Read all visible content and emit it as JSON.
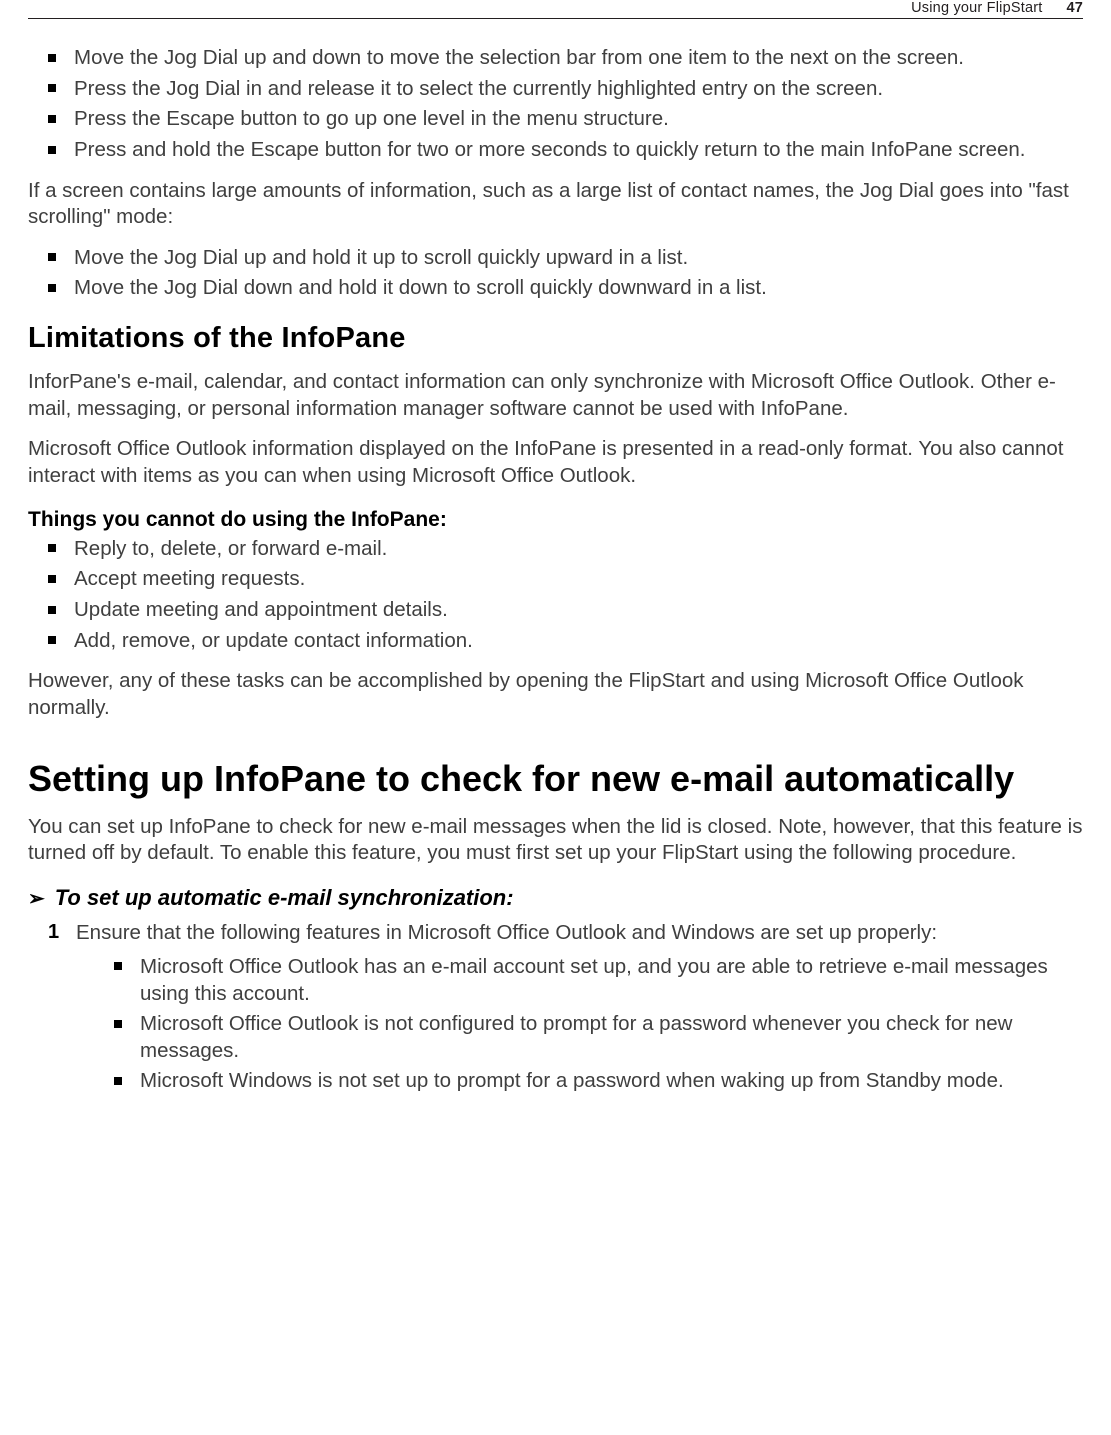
{
  "header": {
    "section": "Using your FlipStart",
    "page": "47"
  },
  "bullets_top": [
    "Move the Jog Dial up and down to move the selection bar from one item to the next on the screen.",
    "Press the Jog Dial in and release it to select the currently highlighted entry on the screen.",
    "Press the Escape button to go up one level in the menu structure.",
    "Press and hold the Escape button for two or more seconds to quickly return to the main InfoPane screen."
  ],
  "para_fastscroll": "If a screen contains large amounts of information, such as a large list of contact names, the Jog Dial goes into \"fast scrolling\" mode:",
  "bullets_fast": [
    "Move the Jog Dial up and hold it up to scroll quickly upward in a list.",
    "Move the Jog Dial down and hold it down to scroll quickly downward in a list."
  ],
  "h2_limitations": "Limitations of the InfoPane",
  "para_lim1": "InforPane's e-mail, calendar, and contact information can only synchronize with Microsoft Office Outlook. Other e-mail, messaging, or personal information manager software cannot be used with InfoPane.",
  "para_lim2": "Microsoft Office Outlook information displayed on the InfoPane is presented in a read-only format. You also cannot interact with items as you can when using Microsoft Office Outlook.",
  "subhead_cannot": "Things you cannot do using the InfoPane:",
  "bullets_cannot": [
    "Reply to, delete, or forward e-mail.",
    "Accept meeting requests.",
    "Update meeting and appointment details.",
    "Add, remove, or update contact information."
  ],
  "para_however": "However, any of these tasks can be accomplished by opening the FlipStart and using Microsoft Office Outlook normally.",
  "h1_setup": "Setting up InfoPane to check for new e-mail automatically",
  "para_setup": "You can set up InfoPane to check for new e-mail messages when the lid is closed. Note, however, that this feature is turned off by default. To enable this feature, you must first set up your FlipStart using the following procedure.",
  "proc_title": "To set up automatic e-mail synchronization:",
  "step1_num": "1",
  "step1_text": "Ensure that the following features in Microsoft Office Outlook and Windows are set up properly:",
  "step1_bullets": [
    "Microsoft Office Outlook has an e-mail account set up, and you are able to retrieve e-mail messages using this account.",
    "Microsoft Office Outlook is not configured to prompt for a password whenever you check for new messages.",
    "Microsoft Windows is not set up to prompt for a password when waking up from Standby mode."
  ]
}
